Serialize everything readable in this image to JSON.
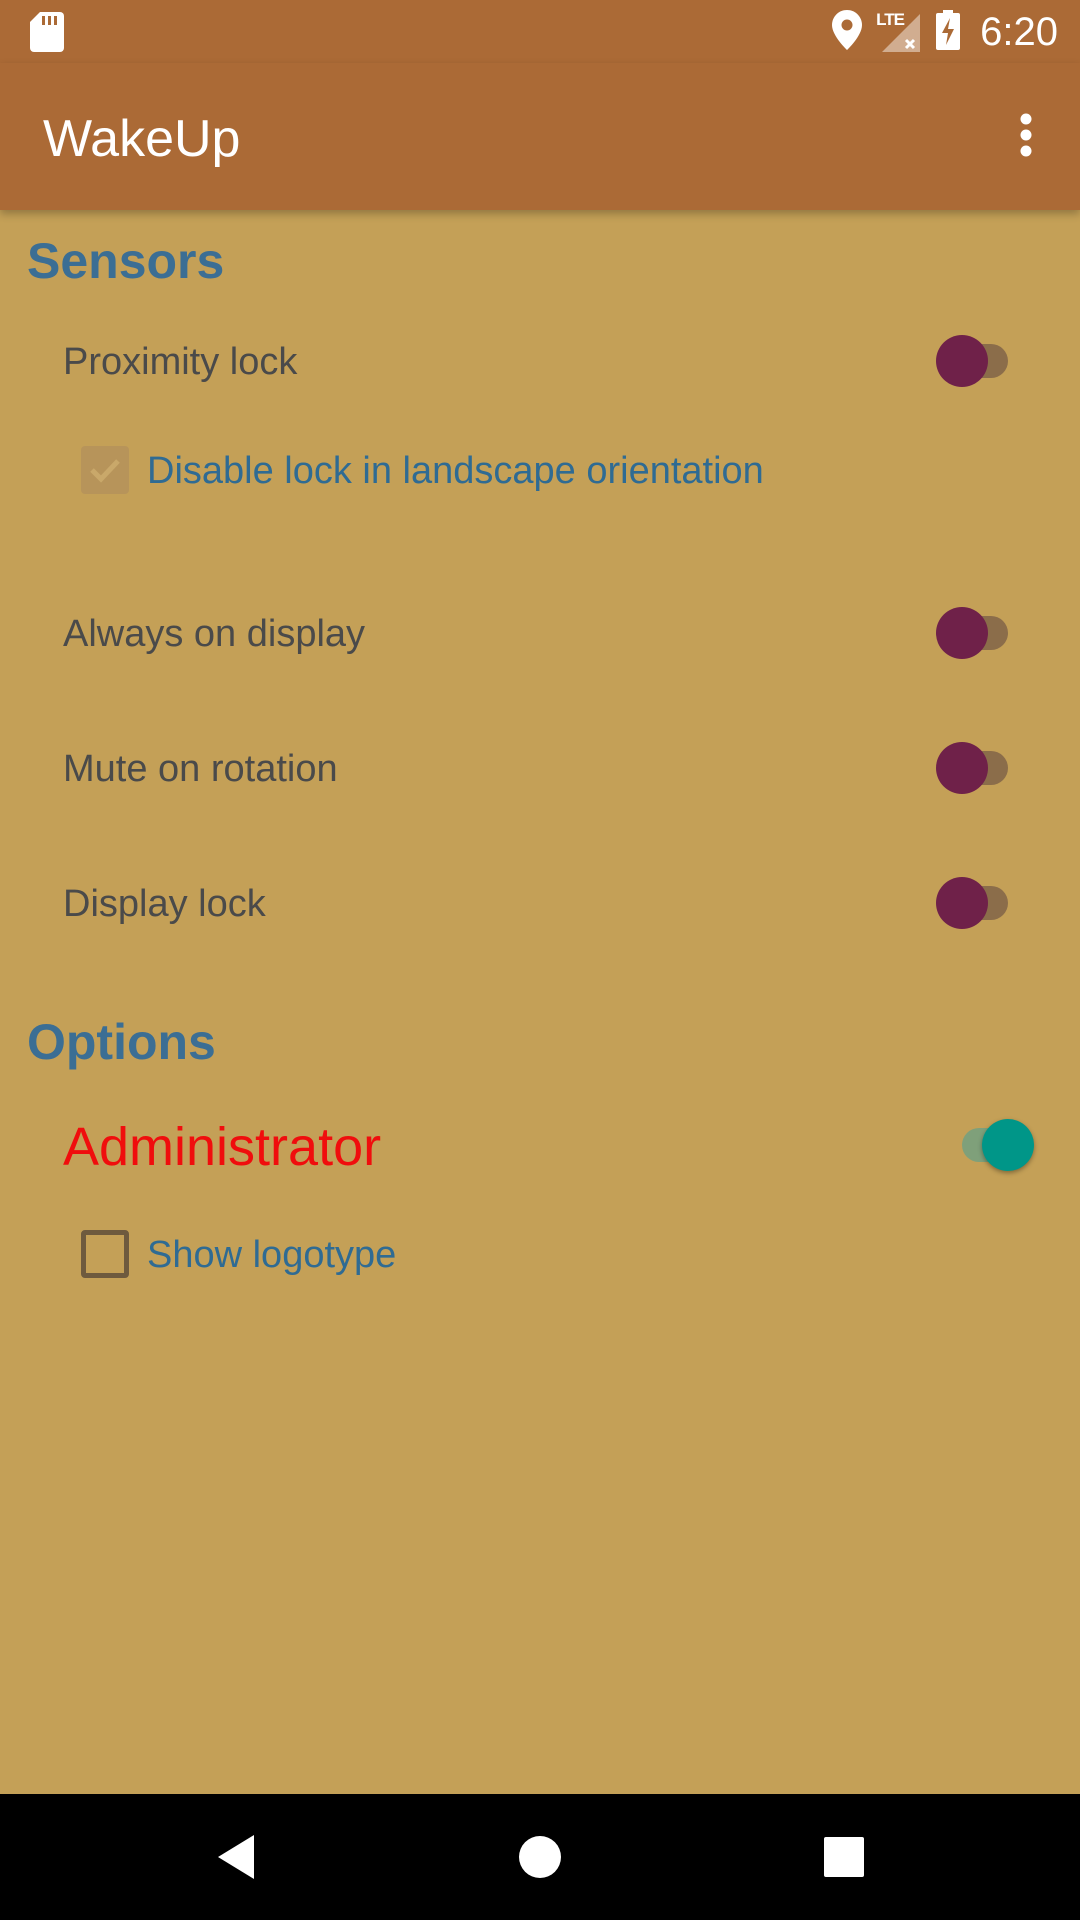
{
  "status_bar": {
    "time": "6:20",
    "network_label": "LTE",
    "icons": [
      "sd-card-icon",
      "location-icon",
      "signal-lte-icon",
      "battery-charging-icon"
    ]
  },
  "app_bar": {
    "title": "WakeUp",
    "overflow_icon": "more-vert-icon"
  },
  "sections": {
    "sensors": {
      "title": "Sensors",
      "proximity_lock": {
        "label": "Proximity lock",
        "on": false
      },
      "disable_landscape": {
        "label": "Disable lock in landscape orientation",
        "checked": true
      },
      "always_on_display": {
        "label": "Always on display",
        "on": false
      },
      "mute_on_rotation": {
        "label": "Mute on rotation",
        "on": false
      },
      "display_lock": {
        "label": "Display lock",
        "on": false
      }
    },
    "options": {
      "title": "Options",
      "administrator": {
        "label": "Administrator",
        "on": true
      },
      "show_logotype": {
        "label": "Show logotype",
        "checked": false
      }
    }
  },
  "nav_bar": {
    "buttons": [
      "back-icon",
      "home-icon",
      "recents-icon"
    ]
  },
  "colors": {
    "app_bar": "#ab6a36",
    "background": "#c4a057",
    "section_title": "#3b6e94",
    "switch_off_thumb": "#6f2149",
    "switch_on_thumb": "#009688",
    "admin_text": "#f00d0d"
  }
}
